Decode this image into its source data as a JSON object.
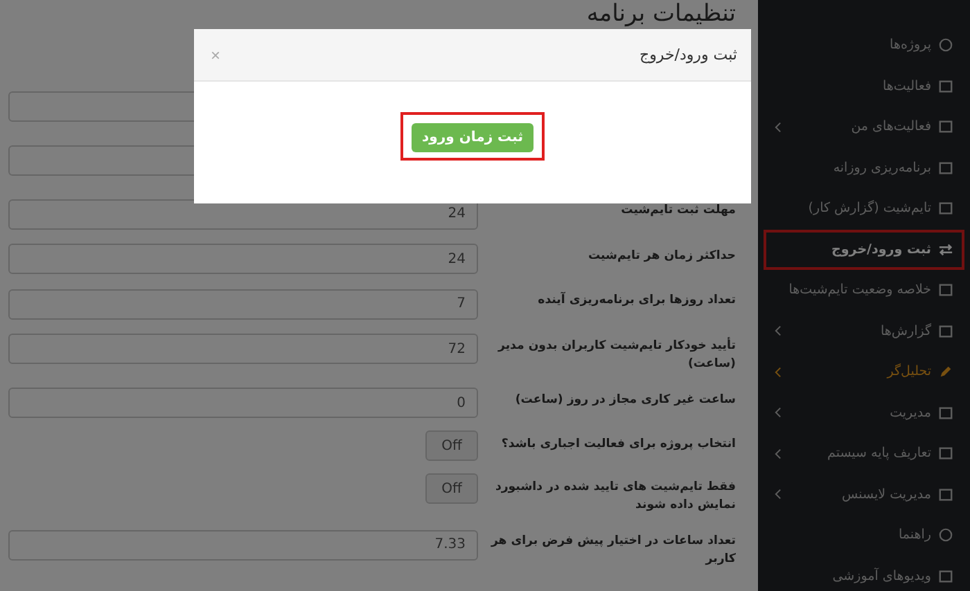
{
  "page_title": "تنظیمات برنامه",
  "settings": [
    {
      "kind": "input"
    },
    {
      "kind": "input"
    },
    {
      "kind": "input",
      "label": "مهلت ثبت تایم‌شیت",
      "value": "24"
    },
    {
      "kind": "input",
      "label": "حداکثر زمان هر تایم‌شیت",
      "value": "24"
    },
    {
      "kind": "input",
      "label": "تعداد روزها برای برنامه‌ریزی آینده",
      "value": "7"
    },
    {
      "kind": "input",
      "label": "تأیید خودکار تایم‌شیت کاربران بدون مدیر (ساعت)",
      "value": "72"
    },
    {
      "kind": "input",
      "label": "ساعت غیر کاری مجاز در روز (ساعت)",
      "value": "0"
    },
    {
      "kind": "toggle",
      "label": "انتخاب پروژه برای فعالیت اجباری باشد؟",
      "state_text": "Off",
      "on": false
    },
    {
      "kind": "toggle",
      "label": "فقط تایم‌شیت های تایید شده در داشبورد نمایش داده شوند",
      "state_text": "Off",
      "on": false
    },
    {
      "kind": "input",
      "label": "تعداد ساعات در اختیار پیش فرض برای هر کاربر",
      "value": "7.33"
    }
  ],
  "sidebar": {
    "items": [
      {
        "label": "پروژه‌ها",
        "expandable": false,
        "selected": false,
        "accent": false,
        "highlighted": false
      },
      {
        "label": "فعالیت‌ها",
        "expandable": false,
        "selected": false,
        "accent": false,
        "highlighted": false
      },
      {
        "label": "فعالیت‌های من",
        "expandable": true,
        "selected": false,
        "accent": false,
        "highlighted": false
      },
      {
        "label": "برنامه‌ریزی روزانه",
        "expandable": false,
        "selected": false,
        "accent": false,
        "highlighted": false
      },
      {
        "label": "تایم‌شیت (گزارش کار)",
        "expandable": false,
        "selected": false,
        "accent": false,
        "highlighted": false
      },
      {
        "label": "ثبت ورود/خروج",
        "expandable": false,
        "selected": true,
        "accent": false,
        "highlighted": true
      },
      {
        "label": "خلاصه وضعیت تایم‌شیت‌ها",
        "expandable": false,
        "selected": false,
        "accent": false,
        "highlighted": false
      },
      {
        "label": "گزارش‌ها",
        "expandable": true,
        "selected": false,
        "accent": false,
        "highlighted": false
      },
      {
        "label": "تحلیل‌گر",
        "expandable": true,
        "selected": false,
        "accent": true,
        "highlighted": false
      },
      {
        "label": "مدیریت",
        "expandable": true,
        "selected": false,
        "accent": false,
        "highlighted": false
      },
      {
        "label": "تعاریف پایه سیستم",
        "expandable": true,
        "selected": false,
        "accent": false,
        "highlighted": false
      },
      {
        "label": "مدیریت لایسنس",
        "expandable": true,
        "selected": false,
        "accent": false,
        "highlighted": false
      },
      {
        "label": "راهنما",
        "expandable": false,
        "selected": false,
        "accent": false,
        "highlighted": false
      },
      {
        "label": "ویدیوهای آموزشی",
        "expandable": false,
        "selected": false,
        "accent": false,
        "highlighted": false
      }
    ]
  },
  "modal": {
    "title": "ثبت ورود/خروج",
    "close": "×",
    "button": {
      "label": "ثبت زمان ورود",
      "highlighted": true
    }
  }
}
